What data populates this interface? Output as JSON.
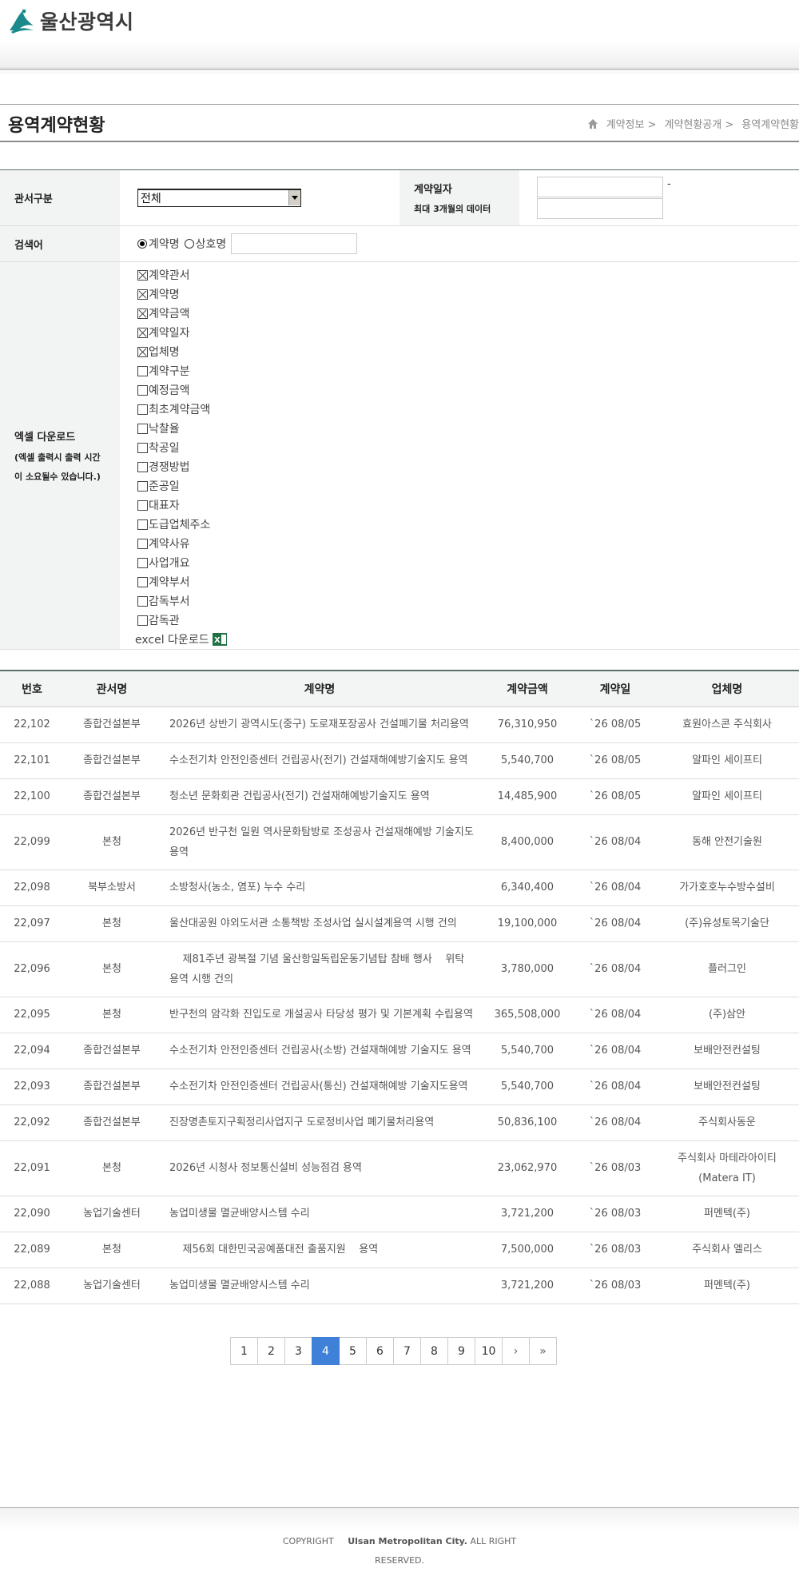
{
  "header": {
    "logo_text": "울산광역시"
  },
  "page": {
    "title": "용역계약현황",
    "breadcrumb": [
      "계약정보 >",
      "계약현황공개 >",
      "용역계약현황"
    ]
  },
  "form": {
    "dept_label": "관서구분",
    "dept_selected": "전체",
    "date_label": "계약일자",
    "date_note": "최대 3개월의 데이터",
    "date_separator": "-",
    "keyword_label": "검색어",
    "radio_contract": "계약명",
    "radio_company": "상호명",
    "excel_label": "엑셀 다운로드",
    "excel_note_1": "(엑셀 출력시 출력 시간",
    "excel_note_2": "이 소요될수 있습니다.)",
    "checkboxes": [
      {
        "label": "계약관서",
        "checked": true
      },
      {
        "label": "계약명",
        "checked": true
      },
      {
        "label": "계약금액",
        "checked": true
      },
      {
        "label": "계약일자",
        "checked": true
      },
      {
        "label": "업체명",
        "checked": true
      },
      {
        "label": "계약구분",
        "checked": false
      },
      {
        "label": "예정금액",
        "checked": false
      },
      {
        "label": "최초계약금액",
        "checked": false
      },
      {
        "label": "낙찰율",
        "checked": false
      },
      {
        "label": "착공일",
        "checked": false
      },
      {
        "label": "경쟁방법",
        "checked": false
      },
      {
        "label": "준공일",
        "checked": false
      },
      {
        "label": "대표자",
        "checked": false
      },
      {
        "label": "도급업체주소",
        "checked": false
      },
      {
        "label": "계약사유",
        "checked": false
      },
      {
        "label": "사업개요",
        "checked": false
      },
      {
        "label": "계약부서",
        "checked": false
      },
      {
        "label": "감독부서",
        "checked": false
      },
      {
        "label": "감독관",
        "checked": false
      }
    ],
    "excel_download": "excel 다운로드"
  },
  "table": {
    "headers": [
      "번호",
      "관서명",
      "계약명",
      "계약금액",
      "계약일",
      "업체명"
    ],
    "rows": [
      [
        "22,102",
        "종합건설본부",
        "2026년 상반기 광역시도(중구) 도로재포장공사 건설폐기물 처리용역",
        "76,310,950",
        "`26 08/05",
        "효원아스콘 주식회사"
      ],
      [
        "22,101",
        "종합건설본부",
        "수소전기차 안전인증센터 건립공사(전기) 건설재해예방기술지도 용역",
        "5,540,700",
        "`26 08/05",
        "알파인 세이프티"
      ],
      [
        "22,100",
        "종합건설본부",
        "청소년 문화회관 건립공사(전기) 건설재해예방기술지도 용역",
        "14,485,900",
        "`26 08/05",
        "알파인 세이프티"
      ],
      [
        "22,099",
        "본청",
        "2026년 반구천 일원 역사문화탐방로 조성공사 건설재해예방 기술지도 용역",
        "8,400,000",
        "`26 08/04",
        "동해 안전기술원"
      ],
      [
        "22,098",
        "북부소방서",
        "소방청사(농소, 염포) 누수 수리",
        "6,340,400",
        "`26 08/04",
        "가가호호누수방수설비"
      ],
      [
        "22,097",
        "본청",
        "울산대공원 야외도서관 소통책방 조성사업 실시설계용역 시행 건의",
        "19,100,000",
        "`26 08/04",
        "(주)유성토목기술단"
      ],
      [
        "22,096",
        "본청",
        "    제81주년 광복절 기념 울산항일독립운동기념탑 참배 행사    위탁 용역 시행 건의",
        "3,780,000",
        "`26 08/04",
        "플러그인"
      ],
      [
        "22,095",
        "본청",
        "반구천의 암각화 진입도로 개설공사 타당성 평가 및 기본계획 수립용역",
        "365,508,000",
        "`26 08/04",
        "(주)삼안"
      ],
      [
        "22,094",
        "종합건설본부",
        "수소전기차 안전인증센터 건립공사(소방) 건설재해예방 기술지도 용역",
        "5,540,700",
        "`26 08/04",
        "보배안전컨설팅"
      ],
      [
        "22,093",
        "종합건설본부",
        "수소전기차 안전인증센터 건립공사(통신) 건설재해예방 기술지도용역",
        "5,540,700",
        "`26 08/04",
        "보배안전컨설팅"
      ],
      [
        "22,092",
        "종합건설본부",
        "진장명촌토지구획정리사업지구 도로정비사업 폐기물처리용역",
        "50,836,100",
        "`26 08/04",
        "주식회사동운"
      ],
      [
        "22,091",
        "본청",
        "2026년 시청사 정보통신설비 성능점검 용역",
        "23,062,970",
        "`26 08/03",
        "주식회사 마테라아이티 (Matera IT)"
      ],
      [
        "22,090",
        "농업기술센터",
        "농업미생물 멸균배양시스템 수리",
        "3,721,200",
        "`26 08/03",
        "퍼멘텍(주)"
      ],
      [
        "22,089",
        "본청",
        "    제56회 대한민국공예품대전 출품지원    용역",
        "7,500,000",
        "`26 08/03",
        "주식회사 엘리스"
      ],
      [
        "22,088",
        "농업기술센터",
        "농업미생물 멸균배양시스템 수리",
        "3,721,200",
        "`26 08/03",
        "퍼멘텍(주)"
      ]
    ]
  },
  "pager": {
    "pages": [
      "1",
      "2",
      "3",
      "4",
      "5",
      "6",
      "7",
      "8",
      "9",
      "10"
    ],
    "current": "4",
    "next": "›",
    "last": "»"
  },
  "footer": {
    "copyright_prefix": "COPYRIGHT",
    "copyright_org": "Ulsan Metropolitan City.",
    "copyright_suffix": "ALL RIGHT RESERVED."
  },
  "colors": {
    "accent": "#3f80d8",
    "header_bg": "#f3f5f4",
    "rule": "#5b6f67"
  }
}
